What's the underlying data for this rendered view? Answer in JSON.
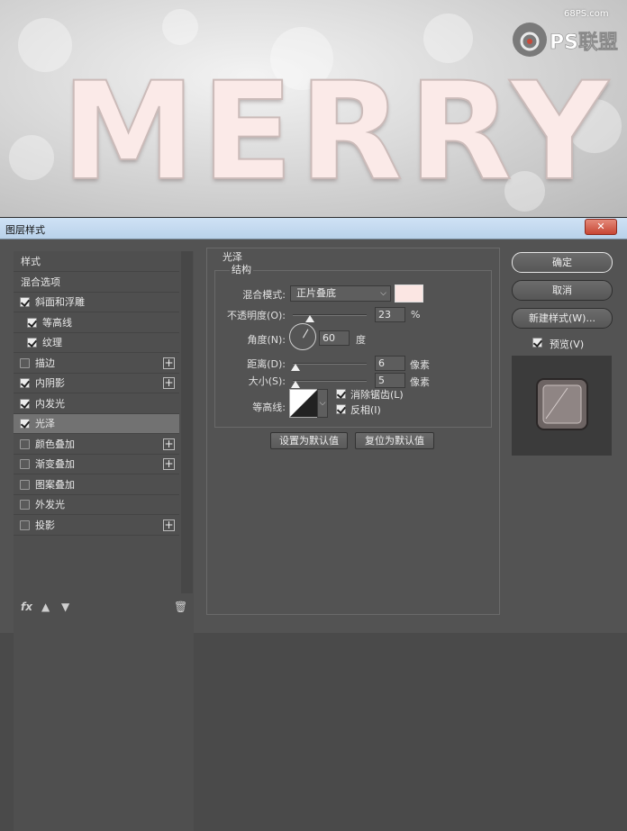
{
  "canvas": {
    "text": "MERRY",
    "watermark_url": "68PS.com",
    "watermark_brand": "PS联盟"
  },
  "dialog": {
    "title": "图层样式",
    "close": "✕"
  },
  "styles": {
    "items": [
      {
        "label": "样式",
        "checkbox": null,
        "plus": false,
        "indent": false,
        "selected": false
      },
      {
        "label": "混合选项",
        "checkbox": null,
        "plus": false,
        "indent": false,
        "selected": false
      },
      {
        "label": "斜面和浮雕",
        "checkbox": true,
        "plus": false,
        "indent": false,
        "selected": false
      },
      {
        "label": "等高线",
        "checkbox": true,
        "plus": false,
        "indent": true,
        "selected": false
      },
      {
        "label": "纹理",
        "checkbox": true,
        "plus": false,
        "indent": true,
        "selected": false
      },
      {
        "label": "描边",
        "checkbox": false,
        "plus": true,
        "indent": false,
        "selected": false
      },
      {
        "label": "内阴影",
        "checkbox": true,
        "plus": true,
        "indent": false,
        "selected": false
      },
      {
        "label": "内发光",
        "checkbox": true,
        "plus": false,
        "indent": false,
        "selected": false
      },
      {
        "label": "光泽",
        "checkbox": true,
        "plus": false,
        "indent": false,
        "selected": true
      },
      {
        "label": "颜色叠加",
        "checkbox": false,
        "plus": true,
        "indent": false,
        "selected": false
      },
      {
        "label": "渐变叠加",
        "checkbox": false,
        "plus": true,
        "indent": false,
        "selected": false
      },
      {
        "label": "图案叠加",
        "checkbox": false,
        "plus": false,
        "indent": false,
        "selected": false
      },
      {
        "label": "外发光",
        "checkbox": false,
        "plus": false,
        "indent": false,
        "selected": false
      },
      {
        "label": "投影",
        "checkbox": false,
        "plus": true,
        "indent": false,
        "selected": false
      }
    ],
    "footer_fx": "fx"
  },
  "satin": {
    "section_title": "光泽",
    "structure_title": "结构",
    "blend_mode_label": "混合模式:",
    "blend_mode_value": "正片叠底",
    "blend_color": "#fbe6e3",
    "opacity_label": "不透明度(O):",
    "opacity_value": "23",
    "opacity_unit": "%",
    "opacity_level": 0.23,
    "angle_label": "角度(N):",
    "angle_value": "60",
    "angle_unit": "度",
    "distance_label": "距离(D):",
    "distance_value": "6",
    "distance_unit": "像素",
    "size_label": "大小(S):",
    "size_value": "5",
    "size_unit": "像素",
    "contour_label": "等高线:",
    "antialias_label": "消除锯齿(L)",
    "antialias_checked": true,
    "invert_label": "反相(I)",
    "invert_checked": true,
    "set_default_label": "设置为默认值",
    "reset_default_label": "复位为默认值"
  },
  "actions": {
    "ok_label": "确定",
    "cancel_label": "取消",
    "new_style_label": "新建样式(W)...",
    "preview_label": "预览(V)",
    "preview_checked": true
  }
}
